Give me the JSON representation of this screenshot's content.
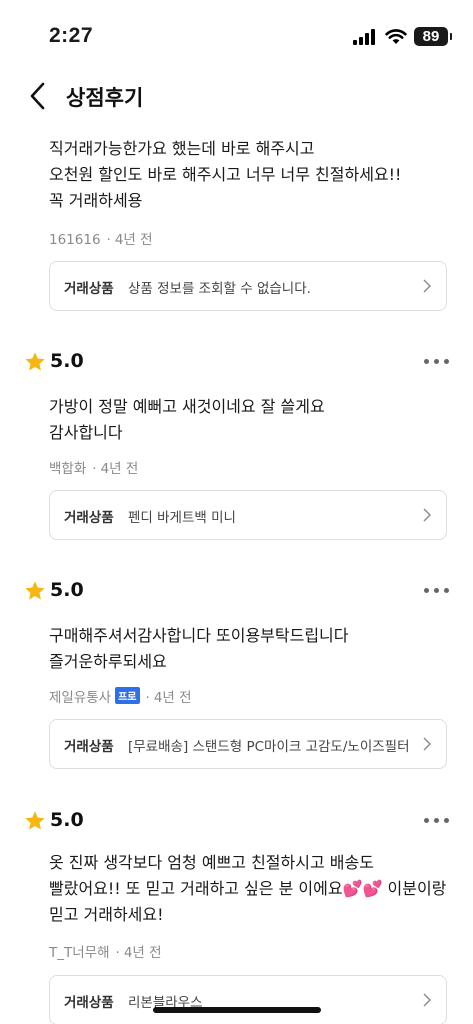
{
  "status_bar": {
    "time": "2:27",
    "battery": "89"
  },
  "nav": {
    "title": "상점후기"
  },
  "reviews": [
    {
      "rating": "",
      "text": "직거래가능한가요 했는데 바로 해주시고\n오천원 할인도 바로 해주시고 너무 너무 친절하세요!!\n꼭 거래하세용",
      "author": "161616",
      "author_badge": "",
      "time": "4년 전",
      "product_label": "거래상품",
      "product": "상품 정보를 조회할 수 없습니다."
    },
    {
      "rating": "5.0",
      "text": "가방이 정말 예뻐고 새것이네요 잘 쓸게요\n감사합니다",
      "author": "백합화",
      "author_badge": "",
      "time": "4년 전",
      "product_label": "거래상품",
      "product": "펜디 바게트백 미니"
    },
    {
      "rating": "5.0",
      "text": "구매해주셔서감사합니다 또이용부탁드립니다 즐거운하루되세요",
      "author": "제일유통사",
      "author_badge": "프로",
      "time": "4년 전",
      "product_label": "거래상품",
      "product": "[무료배송] 스탠드형 PC마이크 고감도/노이즈필터"
    },
    {
      "rating": "5.0",
      "text": "옷 진짜 생각보다 엄청 예쁘고 친절하시고 배송도 빨랐어요!! 또 믿고 거래하고 싶은 분 이에요💕💕 이분이랑 믿고 거래하세요!",
      "author": "T_T너무해",
      "author_badge": "",
      "time": "4년 전",
      "product_label": "거래상품",
      "product": "리본블라우스"
    }
  ],
  "colors": {
    "star": "#f5b70f",
    "pro_badge": "#2f6fe8",
    "meta_text": "#8a8a8a",
    "card_border": "#dedede"
  },
  "icons": [
    "back-icon",
    "star-icon",
    "more-icon",
    "chevron-right-icon",
    "signal-icon",
    "wifi-icon",
    "battery-icon"
  ]
}
